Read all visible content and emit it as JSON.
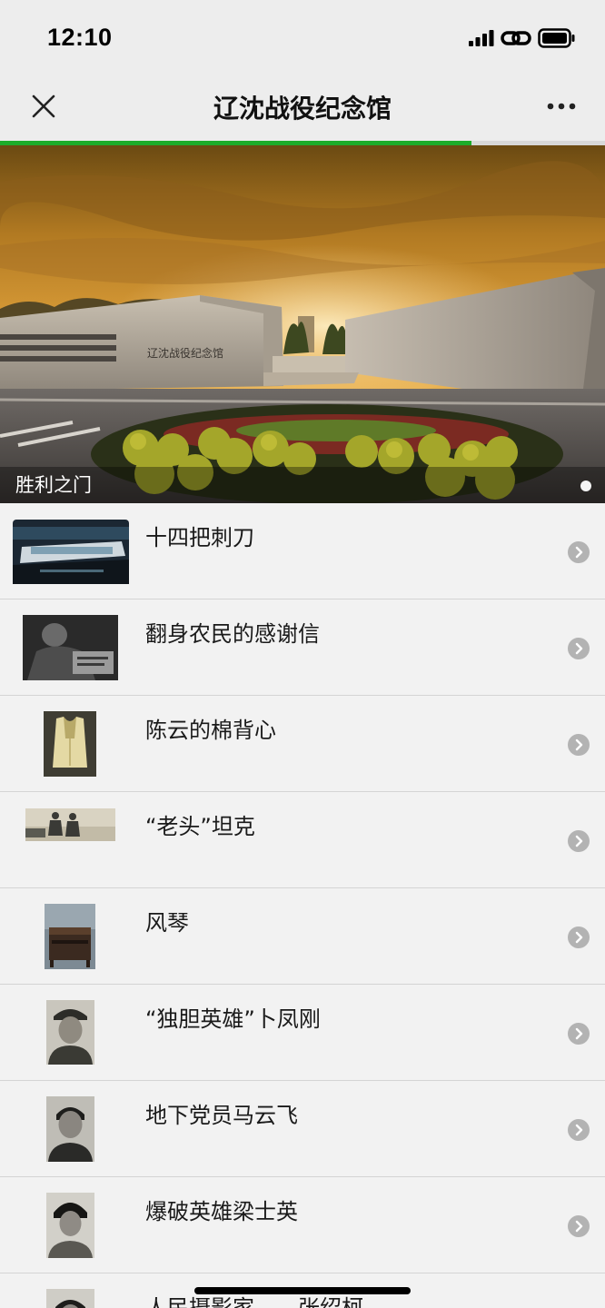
{
  "status_bar": {
    "time": "12:10"
  },
  "nav": {
    "title": "辽沈战役纪念馆",
    "close_icon": "close-icon",
    "more_icon": "more-icon"
  },
  "page_load_progress": 0.78,
  "banner": {
    "caption": "胜利之门",
    "building_sign": "辽沈战役纪念馆",
    "slide_count": 1,
    "active_slide": 1
  },
  "list": {
    "items": [
      {
        "title": "十四把刺刀",
        "thumb": "exhibition-hall-photo"
      },
      {
        "title": "翻身农民的感谢信",
        "thumb": "black-white-writing-photo"
      },
      {
        "title": "陈云的棉背心",
        "thumb": "cotton-vest-photo"
      },
      {
        "title": "“老头”坦克",
        "thumb": "tank-soldiers-photo"
      },
      {
        "title": "风琴",
        "thumb": "organ-photo"
      },
      {
        "title": "“独胆英雄”卜凤刚",
        "thumb": "soldier-portrait-photo"
      },
      {
        "title": "地下党员马云飞",
        "thumb": "man-portrait-photo"
      },
      {
        "title": "爆破英雄梁士英",
        "thumb": "hero-portrait-photo"
      },
      {
        "title": "人民摄影家——张绍柯",
        "thumb": "photographer-portrait-photo"
      }
    ]
  },
  "colors": {
    "progress": "#1dac2a",
    "background": "#ededed"
  }
}
